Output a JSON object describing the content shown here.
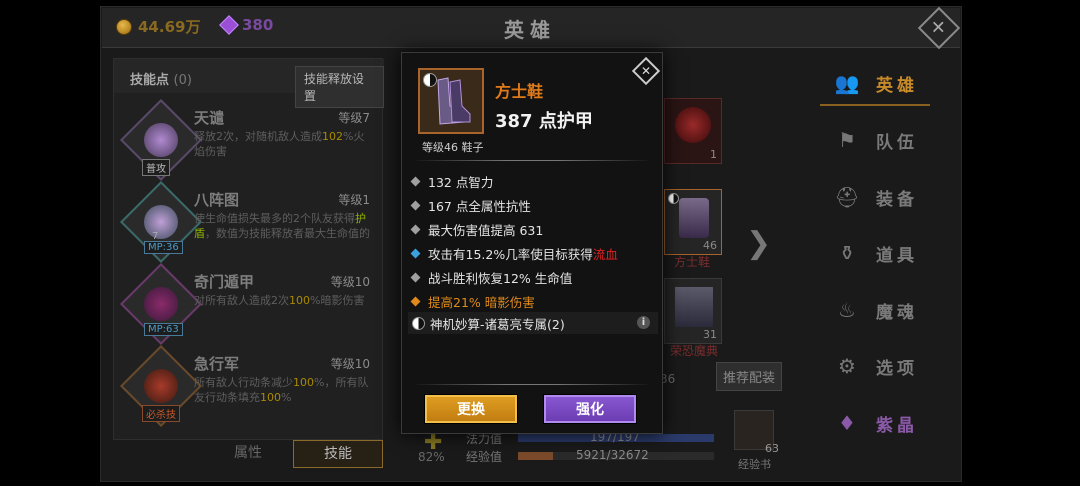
{
  "header": {
    "coins": "44.69万",
    "gems": "380",
    "title": "英雄"
  },
  "skills_panel": {
    "label": "技能点",
    "count": "(0)",
    "release_button": "技能释放设置",
    "skills": [
      {
        "name": "天谴",
        "level": "等级7",
        "desc_a": "释放2次，对随机敌人造成",
        "desc_hl": "102",
        "desc_b": "%火焰伤害",
        "badge": "普攻"
      },
      {
        "name": "八阵图",
        "level": "等级1",
        "desc_a": "使生命值损失最多的2个队友获得",
        "desc_hl": "护盾",
        "desc_b": "，数值为技能释放者最大生命值的",
        "badge": "MP:36",
        "badge_num": "7"
      },
      {
        "name": "奇门遁甲",
        "level": "等级10",
        "desc_a": "对所有敌人造成2次",
        "desc_hl": "100",
        "desc_b": "%暗影伤害",
        "badge": "MP:63"
      },
      {
        "name": "急行军",
        "level": "等级10",
        "desc_a": "所有敌人行动条减少",
        "desc_hl": "100",
        "desc_b": "%，所有队友行动条填充",
        "desc_hl2": "100",
        "desc_c": "%",
        "badge": "必杀技"
      }
    ],
    "tabs": [
      "属性",
      "技能"
    ]
  },
  "hero_area": {
    "slot1_num": "1",
    "slot2_num": "46",
    "slot2_name": "方士鞋",
    "slot3_num": "31",
    "slot3_name": "荣恐魔典",
    "recommend": "推荐配装",
    "partial_num": "36",
    "mp_label": "法力值",
    "mp_value": "197/197",
    "exp_label": "经验值",
    "exp_value": "5921/32672",
    "exp_fraction": 0.181,
    "percent": "82%",
    "exp_book_count": "63",
    "exp_book_label": "经验书"
  },
  "nav": {
    "items": [
      "英雄",
      "队伍",
      "装备",
      "道具",
      "魔魂",
      "选项",
      "紫晶"
    ]
  },
  "popup": {
    "item_name": "方士鞋",
    "main_stat": "387 点护甲",
    "level_type": "等级46 鞋子",
    "attributes": [
      "132 点智力",
      "167 点全属性抗性",
      "最大伤害值提高 631"
    ],
    "proc_a": "攻击有15.2%几率使目标获得",
    "proc_red": "流血",
    "regen": "战斗胜利恢复12% 生命值",
    "shadow": "提高21% 暗影伤害",
    "set_bonus": "神机妙算-诸葛亮专属(2)",
    "btn_swap": "更换",
    "btn_enhance": "强化"
  },
  "colors": {
    "orange": "#e08a1a",
    "red": "#e02020",
    "blue": "#3aa0e0",
    "purple_btn": "#7a4ac2",
    "gold_btn": "#d08a18"
  }
}
